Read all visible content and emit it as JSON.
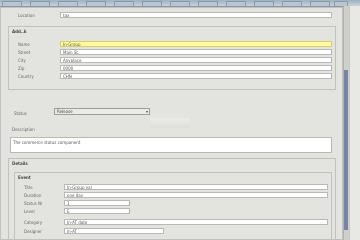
{
  "toolbar": {
    "tabs": [
      "",
      "",
      "",
      "",
      "",
      "",
      "",
      "",
      "",
      "",
      "",
      "",
      ""
    ]
  },
  "top_row": {
    "label": "Location",
    "value": "tax"
  },
  "address": {
    "section_title": "Add..k",
    "fields": [
      {
        "label": "Name",
        "value": "In-Group"
      },
      {
        "label": "Street",
        "value": "Main St."
      },
      {
        "label": "City",
        "value": "Anyplace"
      },
      {
        "label": "Zip",
        "value": "0000"
      },
      {
        "label": "Country",
        "value": "CHN"
      }
    ]
  },
  "type_row": {
    "label": "Status",
    "select_value": "Release",
    "arrow": "▾"
  },
  "description": {
    "label": "Description",
    "value": "The commerce status component"
  },
  "details": {
    "section_title": "Details",
    "group_title": "Event",
    "fields": [
      {
        "label": "Title",
        "value": "In-Group val"
      },
      {
        "label": "Duration",
        "value": "one day"
      },
      {
        "label": "Status Nr",
        "value": "1"
      },
      {
        "label": "Level",
        "value": "E"
      },
      {
        "label": "Category",
        "value": "In-AT date"
      },
      {
        "label": "Designer",
        "value": "In-AT"
      }
    ]
  }
}
